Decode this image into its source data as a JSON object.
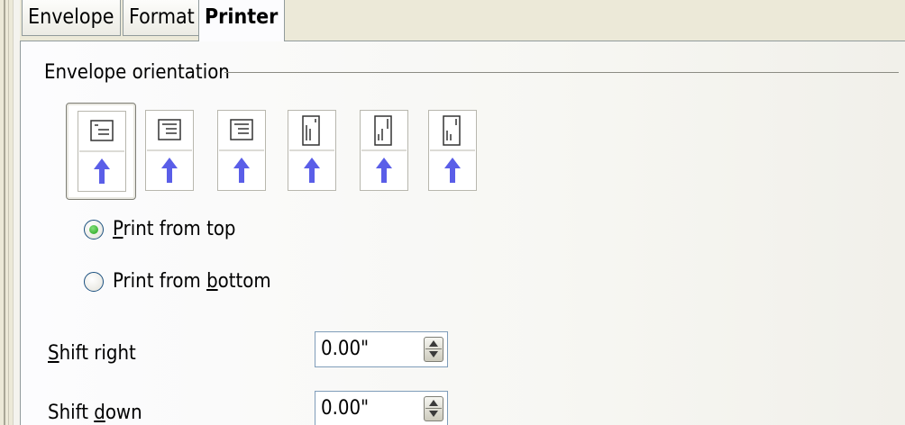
{
  "tabs": [
    {
      "label": "Envelope",
      "active": false
    },
    {
      "label": "Format",
      "active": false
    },
    {
      "label": "Printer",
      "active": true
    }
  ],
  "orientation": {
    "group_title": "Envelope orientation",
    "selected_index": 0,
    "options": [
      {
        "icon": "envelope-landscape-icon"
      },
      {
        "icon": "envelope-landscape-icon"
      },
      {
        "icon": "envelope-landscape-icon"
      },
      {
        "icon": "envelope-portrait-icon"
      },
      {
        "icon": "envelope-portrait-icon"
      },
      {
        "icon": "envelope-portrait-icon"
      }
    ]
  },
  "print_direction": {
    "top": {
      "pre": "",
      "accel": "P",
      "post": "rint from top",
      "checked": true
    },
    "bottom": {
      "pre": "Print from ",
      "accel": "b",
      "post": "ottom",
      "checked": false
    }
  },
  "shift": {
    "right": {
      "accel": "S",
      "rest": "hift right",
      "value": "0.00\""
    },
    "down": {
      "pre": "Shift ",
      "accel": "d",
      "rest": "own",
      "value": "0.00\""
    }
  },
  "colors": {
    "arrow": "#5a5ee8",
    "radio_checked": "#21a11a",
    "panel_bg": "#fcfcfe",
    "window_bg": "#ece9d8"
  }
}
